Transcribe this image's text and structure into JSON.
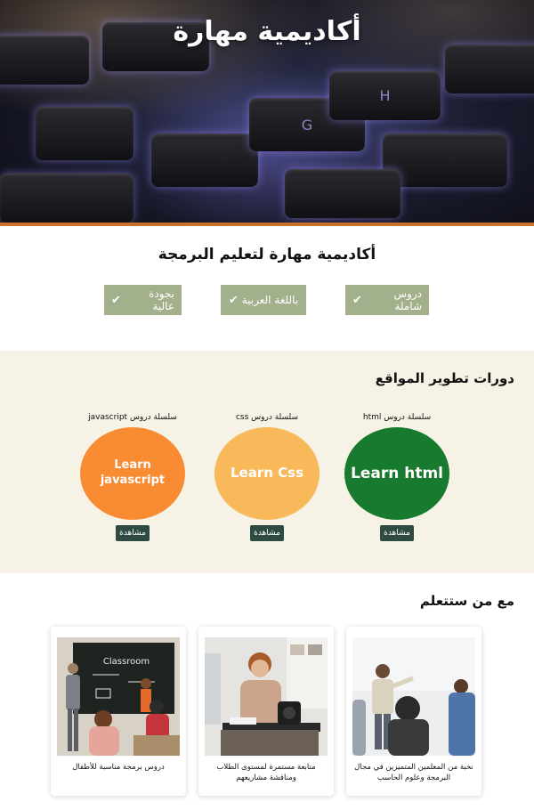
{
  "hero": {
    "title": "أكاديمية مهارة",
    "keys": [
      "G",
      "H"
    ]
  },
  "intro": {
    "heading": "أكاديمية مهارة لتعليم البرمجة",
    "features": [
      {
        "label": "دروس شاملة"
      },
      {
        "label": "باللغة العربية"
      },
      {
        "label": "بجودة عالية"
      }
    ]
  },
  "courses": {
    "title": "دورات تطوير المواقع",
    "items": [
      {
        "caption": "سلسلة دروس html",
        "circle_text": "Learn html",
        "color": "#187a2e",
        "button": "مشاهدة"
      },
      {
        "caption": "سلسلة دروس css",
        "circle_text": "Learn Css",
        "color": "#f9b85a",
        "button": "مشاهدة"
      },
      {
        "caption": "سلسلة دروس javascript",
        "circle_text": "Learn javascript",
        "color": "#f98b32",
        "button": "مشاهدة"
      }
    ]
  },
  "teachers": {
    "title": "مع من ستتعلم",
    "cards": [
      {
        "text": "نخبة من المعلمين المتميزين في مجال البرمجة وعلوم الحاسب"
      },
      {
        "text": "متابعة مستمرة لمستوى الطلاب ومناقشة مشاريعهم"
      },
      {
        "text": "دروس برمجة مناسبة للأطفال"
      }
    ],
    "board_text": "Classroom"
  },
  "colors": {
    "accent": "#c9702b",
    "feature_bg": "#a2b08c",
    "courses_bg": "#f6f3e6",
    "button_bg": "#2f4a43"
  }
}
